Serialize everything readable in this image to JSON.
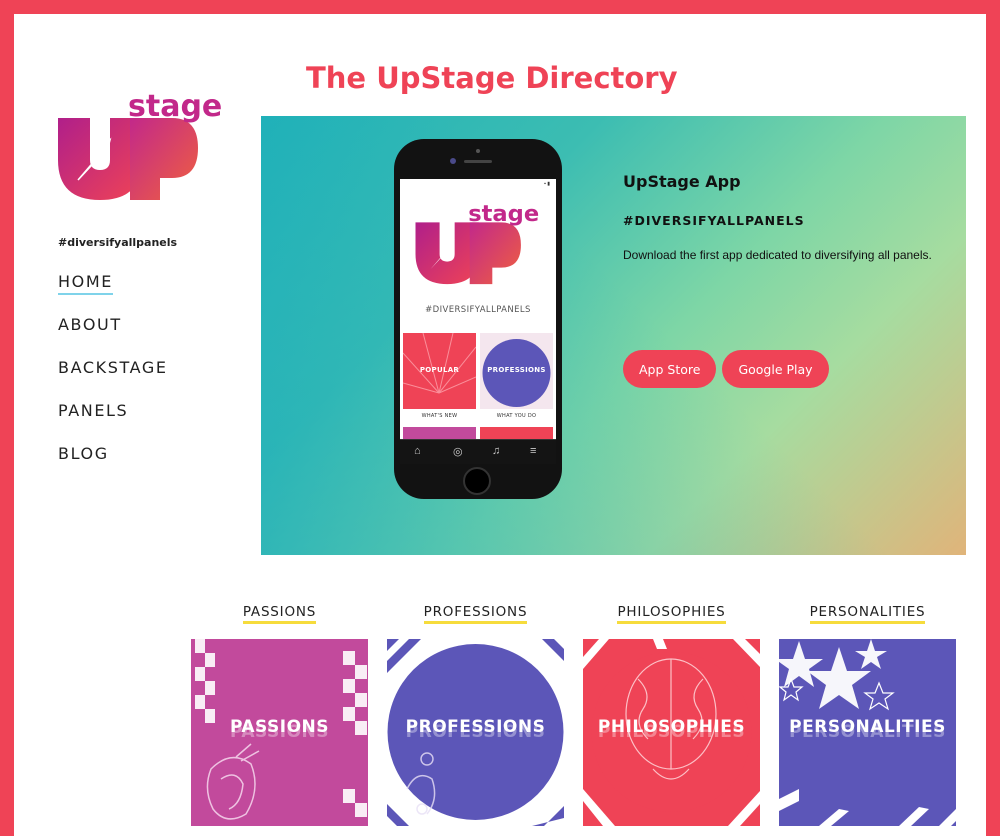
{
  "site": {
    "title": "The UpStage Directory",
    "logo_text_top": "stage",
    "logo_text_main": "UP",
    "tagline": "#diversifyallpanels",
    "brand_color": "#ef4356"
  },
  "nav": {
    "items": [
      {
        "label": "HOME",
        "active": true
      },
      {
        "label": "ABOUT"
      },
      {
        "label": "BACKSTAGE"
      },
      {
        "label": "PANELS"
      },
      {
        "label": "BLOG"
      }
    ]
  },
  "hero": {
    "app_title": "UpStage App",
    "hashtag": "#DIVERSIFYALLPANELS",
    "description": "Download the first app dedicated to diversifying all panels.",
    "buttons": {
      "app_store": "App Store",
      "google_play": "Google Play"
    },
    "phone": {
      "hashtag": "#DIVERSIFYALLPANELS",
      "tiles": [
        {
          "label": "POPULAR",
          "caption": "WHAT'S NEW"
        },
        {
          "label": "PROFESSIONS",
          "caption": "WHAT YOU DO"
        }
      ]
    }
  },
  "categories": [
    {
      "link": "PASSIONS",
      "label": "PASSIONS",
      "color": "#c24a9c"
    },
    {
      "link": "PROFESSIONS",
      "label": "PROFESSIONS",
      "color": "#5c56b8"
    },
    {
      "link": "PHILOSOPHIES",
      "label": "PHILOSOPHIES",
      "color": "#ef4356"
    },
    {
      "link": "PERSONALITIES",
      "label": "PERSONALITIES",
      "color": "#5c56b8"
    }
  ]
}
